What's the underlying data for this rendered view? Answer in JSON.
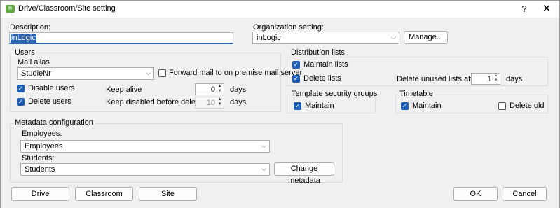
{
  "window": {
    "title": "Drive/Classroom/Site setting",
    "app_icon": "app-icon",
    "help": "?",
    "close": "✕"
  },
  "description": {
    "label": "Description:",
    "value": "inLogic"
  },
  "organization": {
    "label": "Organization setting:",
    "value": "inLogic",
    "manage_label": "Manage..."
  },
  "users": {
    "group_title": "Users",
    "mail_alias_label": "Mail alias",
    "mail_alias_value": "StudieNr",
    "forward_mail": {
      "label": "Forward mail to on premise mail server",
      "checked": false
    },
    "disable_users": {
      "label": "Disable users",
      "checked": true
    },
    "delete_users": {
      "label": "Delete users",
      "checked": true
    },
    "keep_alive": {
      "label": "Keep alive",
      "value": "0",
      "unit": "days"
    },
    "keep_disabled": {
      "label": "Keep disabled before deleting",
      "value": "10",
      "unit": "days"
    }
  },
  "distribution": {
    "group_title": "Distribution lists",
    "maintain_lists": {
      "label": "Maintain lists",
      "checked": true
    },
    "delete_lists": {
      "label": "Delete lists",
      "checked": true
    },
    "delete_unused": {
      "label": "Delete unused lists after",
      "value": "1",
      "unit": "days"
    }
  },
  "template_security": {
    "group_title": "Template security groups",
    "maintain": {
      "label": "Maintain",
      "checked": true
    }
  },
  "timetable": {
    "group_title": "Timetable",
    "maintain": {
      "label": "Maintain",
      "checked": true
    },
    "delete_old": {
      "label": "Delete old",
      "checked": false
    }
  },
  "metadata": {
    "group_title": "Metadata configuration",
    "employees_label": "Employees:",
    "employees_value": "Employees",
    "students_label": "Students:",
    "students_value": "Students",
    "change_label": "Change metadata"
  },
  "footer": {
    "drive": "Drive",
    "classroom": "Classroom",
    "site": "Site",
    "ok": "OK",
    "cancel": "Cancel"
  },
  "colors": {
    "accent": "#1f5fb8",
    "dialog_bg": "#f0f0f0",
    "app_icon": "#5aa83c"
  }
}
